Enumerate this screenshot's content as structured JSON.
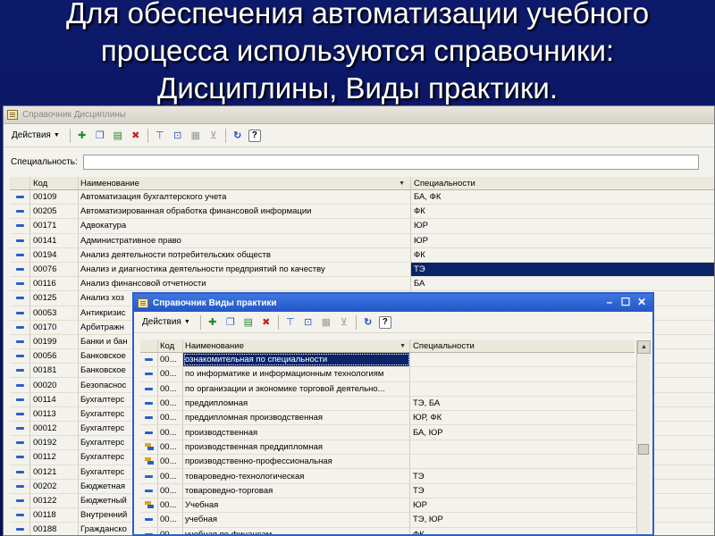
{
  "slide": {
    "title_lines": [
      "Для обеспечения автоматизации учебного",
      "процесса используются справочники:",
      "Дисциплины, Виды практики."
    ]
  },
  "window1": {
    "title": "Справочник Дисциплины",
    "actions_label": "Действия",
    "filter_label": "Специальность:",
    "filter_value": "",
    "columns": {
      "code": "Код",
      "name": "Наименование",
      "spec": "Специальности"
    },
    "rows": [
      {
        "code": "00109",
        "name": "Автоматизация бухгалтерского учета",
        "spec": "БА, ФК"
      },
      {
        "code": "00205",
        "name": "Автоматизированная обработка финансовой информации",
        "spec": "ФК"
      },
      {
        "code": "00171",
        "name": "Адвокатура",
        "spec": "ЮР"
      },
      {
        "code": "00141",
        "name": "Административное право",
        "spec": "ЮР"
      },
      {
        "code": "00194",
        "name": "Анализ деятельности потребительских обществ",
        "spec": "ФК"
      },
      {
        "code": "00076",
        "name": "Анализ и диагностика деятельности предприятий по качеству",
        "spec": "ТЭ",
        "selected": true
      },
      {
        "code": "00116",
        "name": "Анализ финансовой отчетности",
        "spec": "БА"
      },
      {
        "code": "00125",
        "name": "Анализ хоз",
        "spec": ""
      },
      {
        "code": "00053",
        "name": "Антикризис",
        "spec": ""
      },
      {
        "code": "00170",
        "name": "Арбитражн",
        "spec": ""
      },
      {
        "code": "00199",
        "name": "Банки и бан",
        "spec": ""
      },
      {
        "code": "00056",
        "name": "Банковское",
        "spec": ""
      },
      {
        "code": "00181",
        "name": "Банковское",
        "spec": ""
      },
      {
        "code": "00020",
        "name": "Безопаснос",
        "spec": ""
      },
      {
        "code": "00114",
        "name": "Бухгалтерс",
        "spec": ""
      },
      {
        "code": "00113",
        "name": "Бухгалтерс",
        "spec": ""
      },
      {
        "code": "00012",
        "name": "Бухгалтерс",
        "spec": ""
      },
      {
        "code": "00192",
        "name": "Бухгалтерс",
        "spec": ""
      },
      {
        "code": "00112",
        "name": "Бухгалтерс",
        "spec": ""
      },
      {
        "code": "00121",
        "name": "Бухгалтерс",
        "spec": ""
      },
      {
        "code": "00202",
        "name": "Бюджетная",
        "spec": ""
      },
      {
        "code": "00122",
        "name": "Бюджетный",
        "spec": ""
      },
      {
        "code": "00118",
        "name": "Внутренний",
        "spec": ""
      },
      {
        "code": "00188",
        "name": "Гражданско",
        "spec": ""
      }
    ]
  },
  "window2": {
    "title": "Справочник Виды практики",
    "actions_label": "Действия",
    "columns": {
      "code": "Код",
      "name": "Наименование",
      "spec": "Специальности"
    },
    "rows": [
      {
        "icon": "dash",
        "code": "00...",
        "name": "ознакомительная по специальности",
        "spec": "",
        "selected": true
      },
      {
        "icon": "dash",
        "code": "00...",
        "name": "по информатике и информационным технологиям",
        "spec": ""
      },
      {
        "icon": "dash",
        "code": "00...",
        "name": "по организации и экономике торговой деятельно...",
        "spec": ""
      },
      {
        "icon": "dash",
        "code": "00...",
        "name": "преддипломная",
        "spec": "ТЭ, БА"
      },
      {
        "icon": "dash",
        "code": "00...",
        "name": "преддипломная производственная",
        "spec": "ЮР, ФК"
      },
      {
        "icon": "dash",
        "code": "00...",
        "name": "производственная",
        "spec": "БА, ЮР"
      },
      {
        "icon": "folder",
        "code": "00...",
        "name": "производственная преддипломная",
        "spec": ""
      },
      {
        "icon": "folder",
        "code": "00...",
        "name": "производственно-профессиональная",
        "spec": ""
      },
      {
        "icon": "dash",
        "code": "00...",
        "name": "товароведно-технологическая",
        "spec": "ТЭ"
      },
      {
        "icon": "dash",
        "code": "00...",
        "name": "товароведно-торговая",
        "spec": "ТЭ"
      },
      {
        "icon": "folder",
        "code": "00...",
        "name": "Учебная",
        "spec": "ЮР"
      },
      {
        "icon": "dash",
        "code": "00...",
        "name": "учебная",
        "spec": "ТЭ, ЮР"
      },
      {
        "icon": "dash",
        "code": "00...",
        "name": "учебная по финансам",
        "spec": "ФК"
      }
    ]
  },
  "icons": [
    "add-icon",
    "copy-icon",
    "add-group-icon",
    "delete-icon",
    "filter-icon",
    "filter-set-icon",
    "list-mode-icon",
    "clear-filter-icon",
    "refresh-icon",
    "help-icon"
  ],
  "colors": {
    "slide_bg": "#0d1a6b",
    "selection": "#0a246a",
    "active_title": "#2256c8",
    "row_marker": "#2a5fc8"
  }
}
